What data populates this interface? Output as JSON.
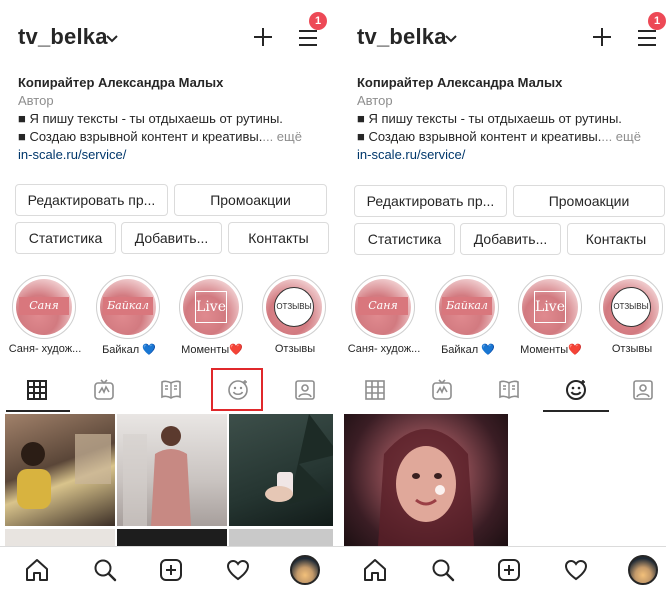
{
  "profile": {
    "username": "tv_belka",
    "notification_count": "1",
    "bio": {
      "name": "Копирайтер Александра Малых",
      "category": "Автор",
      "line1": "■ Я пишу тексты - ты отдыхаешь от рутины.",
      "line2": "■ Создаю взрывной контент и креативы.",
      "more": "... ещё",
      "link": "in-scale.ru/service/"
    }
  },
  "buttons": {
    "edit_profile": "Редактировать пр...",
    "promotions": "Промоакции",
    "statistics": "Статистика",
    "add": "Добавить...",
    "contacts": "Контакты"
  },
  "highlights": [
    {
      "label": "Саня- худож...",
      "badge": "Саня"
    },
    {
      "label": "Байкал 💙",
      "badge": "Байкал"
    },
    {
      "label": "Моменты❤️",
      "badge": "Live"
    },
    {
      "label": "Отзывы",
      "badge": "ОТЗЫВЫ"
    }
  ],
  "tabs": [
    "grid-icon",
    "igtv-icon",
    "guides-icon",
    "effects-icon",
    "tagged-icon"
  ],
  "left_active_tab": "grid",
  "right_active_tab": "effects",
  "bottom_nav": [
    "home-icon",
    "search-icon",
    "new-post-icon",
    "activity-icon",
    "profile-avatar"
  ],
  "colors": {
    "highlight_box": "#e0282b",
    "notification_badge": "#ed4956",
    "link": "#00376b",
    "secondary_text": "#8e8e8e"
  }
}
